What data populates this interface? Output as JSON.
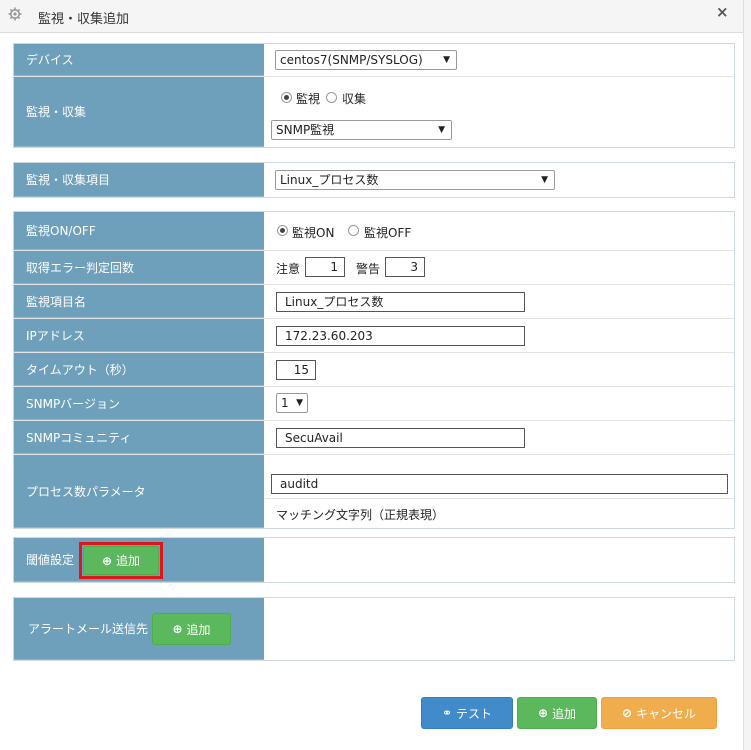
{
  "window": {
    "title": "監視・収集追加"
  },
  "device": {
    "label": "デバイス",
    "selected": "centos7(SNMP/SYSLOG)"
  },
  "monitor_collect": {
    "label": "監視・収集",
    "radio_monitor": "監視",
    "radio_collect": "収集",
    "selected_type": "SNMP監視"
  },
  "item": {
    "label": "監視・収集項目",
    "selected": "Linux_プロセス数"
  },
  "monitor_onoff": {
    "label": "監視ON/OFF",
    "on": "監視ON",
    "off": "監視OFF"
  },
  "error_count": {
    "label": "取得エラー判定回数",
    "warn_label": "注意",
    "warn_value": "1",
    "alert_label": "警告",
    "alert_value": "3"
  },
  "item_name": {
    "label": "監視項目名",
    "value": "Linux_プロセス数"
  },
  "ip": {
    "label": "IPアドレス",
    "value": "172.23.60.203"
  },
  "timeout": {
    "label": "タイムアウト（秒）",
    "value": "15"
  },
  "snmp_version": {
    "label": "SNMPバージョン",
    "selected": "1"
  },
  "snmp_community": {
    "label": "SNMPコミュニティ",
    "value": "SecuAvail"
  },
  "process_param": {
    "label": "プロセス数パラメータ",
    "value": "auditd",
    "hint": "マッチング文字列（正規表現）"
  },
  "threshold": {
    "label": "閾値設定",
    "add_label": "追加"
  },
  "alert_mail": {
    "label": "アラートメール送信先",
    "add_label": "追加"
  },
  "footer": {
    "test_label": "テスト",
    "add_label": "追加",
    "cancel_label": "キャンセル"
  },
  "colors": {
    "label_bg": "#6ea0bc",
    "green": "#5cb85c",
    "blue": "#428bca",
    "orange": "#f0ad4e",
    "highlight": "#e0141c"
  }
}
